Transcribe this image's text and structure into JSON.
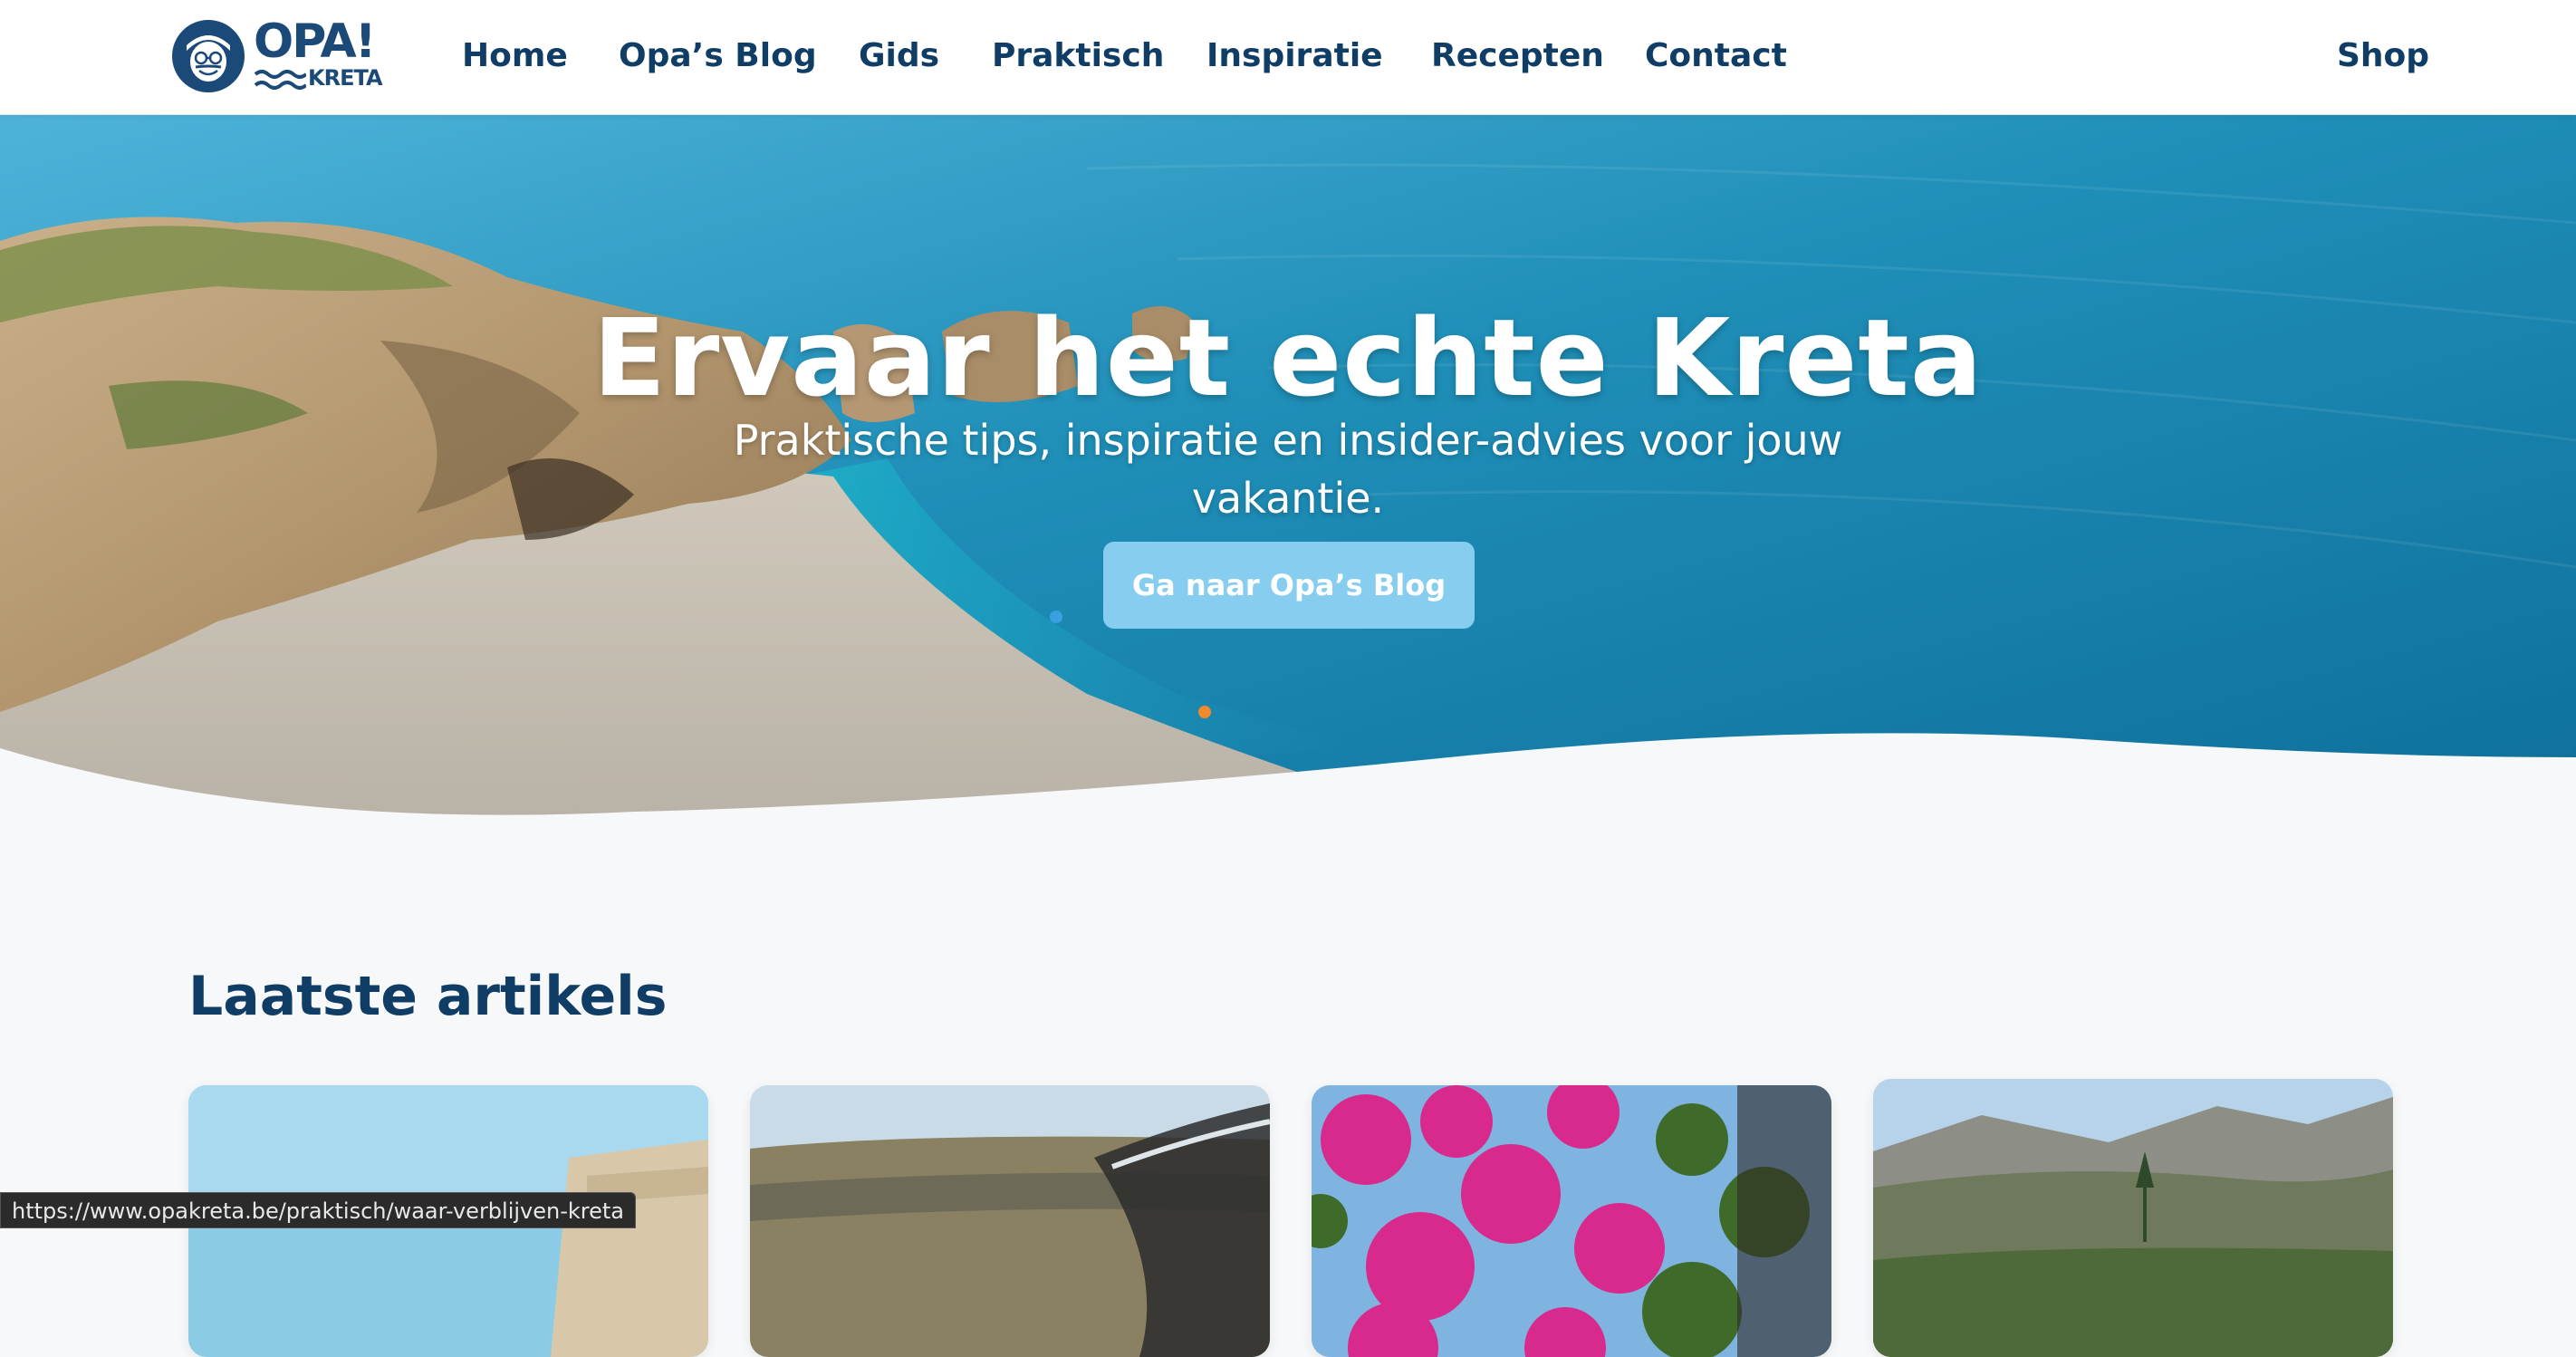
{
  "brand": {
    "logo_text": "OPA!",
    "logo_sub": "KRETA"
  },
  "nav": {
    "items": [
      "Home",
      "Opa’s Blog",
      "Gids",
      "Praktisch",
      "Inspiratie",
      "Recepten",
      "Contact"
    ],
    "shop": "Shop"
  },
  "hero": {
    "title": "Ervaar het echte Kreta",
    "subtitle": "Praktische tips, inspiratie en insider-advies voor jouw vakantie.",
    "cta": "Ga naar Opa’s Blog"
  },
  "articles": {
    "title": "Laatste artikels"
  },
  "statusbar": {
    "url": "https://www.opakreta.be/praktisch/waar-verblijven-kreta"
  },
  "colors": {
    "navy": "#0f3d66",
    "button": "#86cdf0",
    "sea": "#1f8fb8",
    "background": "#f7f8fa"
  }
}
